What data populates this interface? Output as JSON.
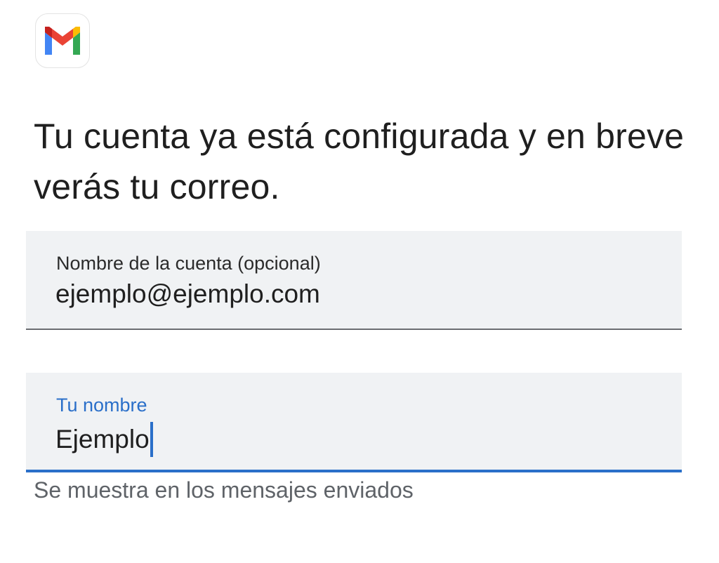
{
  "app": {
    "icon": "gmail-logo-icon",
    "colors": {
      "red": "#ea4335",
      "blue": "#4285f4",
      "yellow": "#fbbc04",
      "green": "#34a853"
    }
  },
  "heading": "Tu cuenta ya está configurada y en breve verás tu correo.",
  "account_field": {
    "label": "Nombre de la cuenta (opcional)",
    "value": "ejemplo@ejemplo.com"
  },
  "name_field": {
    "label": "Tu nombre",
    "value": "Ejemplo",
    "helper": "Se muestra en los mensajes enviados",
    "focus_color": "#2a6fc9"
  }
}
